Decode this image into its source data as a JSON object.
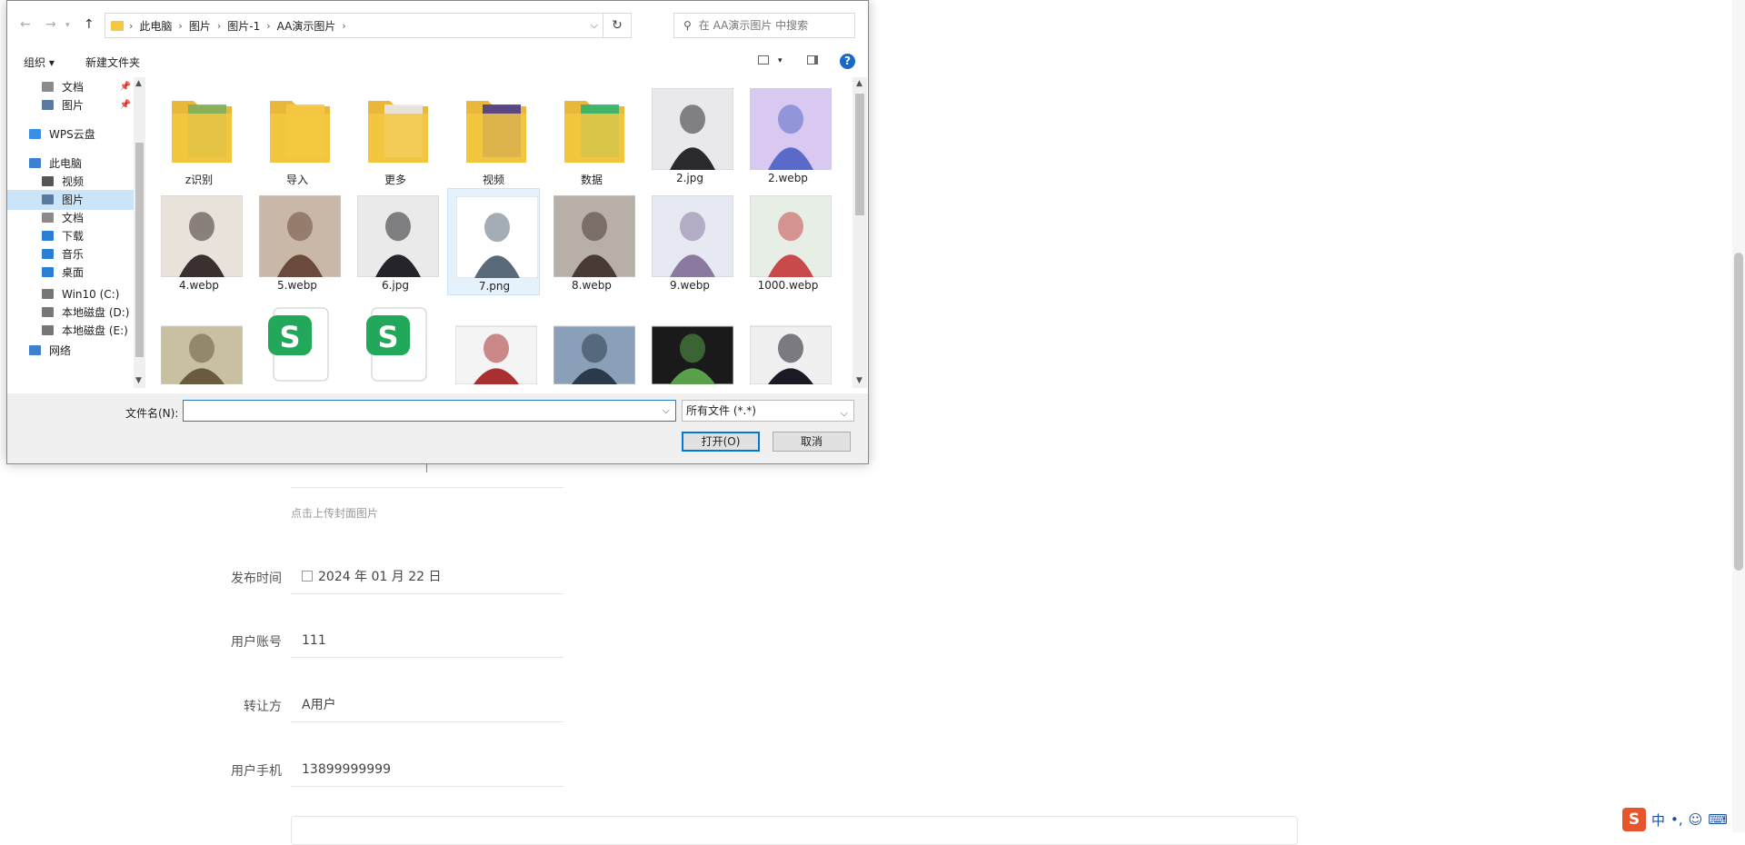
{
  "form": {
    "upload_hint": "点击上传封面图片",
    "rows": [
      {
        "label": "发布时间",
        "value": "2024 年 01 月 22 日",
        "calendar": true
      },
      {
        "label": "用户账号",
        "value": "111"
      },
      {
        "label": "转让方",
        "value": "A用户"
      },
      {
        "label": "用户手机",
        "value": "13899999999"
      }
    ]
  },
  "dialog": {
    "breadcrumb": [
      "此电脑",
      "图片",
      "图片-1",
      "AA演示图片"
    ],
    "search_placeholder": "在 AA演示图片 中搜索",
    "toolbar": {
      "organize": "组织 ▾",
      "new_folder": "新建文件夹"
    },
    "nav": {
      "items": [
        {
          "label": "文档",
          "pinned": true,
          "icon_color": "#8a8a8a"
        },
        {
          "label": "图片",
          "pinned": true,
          "icon_color": "#5a7aa0"
        },
        {
          "label": "WPS云盘",
          "icon_color": "#3a8ee6"
        },
        {
          "label": "此电脑",
          "icon_color": "#3f7fcf"
        },
        {
          "label": "视频",
          "icon_color": "#555555"
        },
        {
          "label": "图片",
          "selected": true,
          "icon_color": "#5a7aa0"
        },
        {
          "label": "文档",
          "icon_color": "#8a8a8a"
        },
        {
          "label": "下载",
          "icon_color": "#2a7fd4"
        },
        {
          "label": "音乐",
          "icon_color": "#2a7fd4"
        },
        {
          "label": "桌面",
          "icon_color": "#2a7fd4"
        },
        {
          "label": "Win10 (C:)",
          "icon_color": "#777777"
        },
        {
          "label": "本地磁盘 (D:)",
          "icon_color": "#777777"
        },
        {
          "label": "本地磁盘 (E:)",
          "icon_color": "#777777"
        },
        {
          "label": "网络",
          "icon_color": "#3f7fcf"
        }
      ]
    },
    "files": [
      {
        "name": "z识别",
        "kind": "folder",
        "colors": [
          "#f5c842",
          "#7fae5a"
        ]
      },
      {
        "name": "导入",
        "kind": "folder",
        "colors": [
          "#f5c842",
          "#f5c842"
        ]
      },
      {
        "name": "更多",
        "kind": "folder",
        "colors": [
          "#f5c842",
          "#e8e8e8"
        ]
      },
      {
        "name": "视频",
        "kind": "folder",
        "colors": [
          "#f5c842",
          "#4a3a8a"
        ]
      },
      {
        "name": "数据",
        "kind": "folder",
        "colors": [
          "#f5c842",
          "#2fb56a"
        ]
      },
      {
        "name": "2.jpg",
        "kind": "image",
        "colors": [
          "#e9e9ec",
          "#2a2a2e"
        ]
      },
      {
        "name": "2.webp",
        "kind": "image",
        "colors": [
          "#d9c9f2",
          "#5a6ac8"
        ]
      },
      {
        "name": "4.webp",
        "kind": "image",
        "colors": [
          "#e8e2da",
          "#3a3030"
        ]
      },
      {
        "name": "5.webp",
        "kind": "image",
        "colors": [
          "#c9b8a8",
          "#6a4a3a"
        ]
      },
      {
        "name": "6.jpg",
        "kind": "image",
        "colors": [
          "#eaeaea",
          "#24242a"
        ]
      },
      {
        "name": "7.png",
        "kind": "image",
        "selected": true,
        "colors": [
          "#ffffff",
          "#5a6a7a"
        ]
      },
      {
        "name": "8.webp",
        "kind": "image",
        "colors": [
          "#b8b0a8",
          "#4a3a36"
        ]
      },
      {
        "name": "9.webp",
        "kind": "image",
        "colors": [
          "#e6e8f2",
          "#8a7aa0"
        ]
      },
      {
        "name": "1000.webp",
        "kind": "image",
        "colors": [
          "#e6eee6",
          "#c84a4a"
        ]
      },
      {
        "name": "",
        "kind": "image",
        "colors": [
          "#c8c0a0",
          "#6a5a40"
        ]
      },
      {
        "name": "",
        "kind": "wps",
        "colors": [
          "#ffffff",
          "#22a85a"
        ]
      },
      {
        "name": "",
        "kind": "wps",
        "colors": [
          "#22a85a",
          "#22a85a"
        ]
      },
      {
        "name": "",
        "kind": "image",
        "colors": [
          "#f4f4f4",
          "#a83030"
        ]
      },
      {
        "name": "",
        "kind": "image",
        "colors": [
          "#8aa0b8",
          "#2a3a4a"
        ]
      },
      {
        "name": "",
        "kind": "image",
        "colors": [
          "#1a1a1a",
          "#5aa04a"
        ]
      },
      {
        "name": "",
        "kind": "image",
        "colors": [
          "#f0f0f0",
          "#1a1a24"
        ]
      }
    ],
    "filename_label": "文件名(N):",
    "filename_value": "",
    "filetype": "所有文件 (*.*)",
    "open_label": "打开(O)",
    "cancel_label": "取消"
  },
  "tray": {
    "ime": "中",
    "punct": "•,"
  }
}
